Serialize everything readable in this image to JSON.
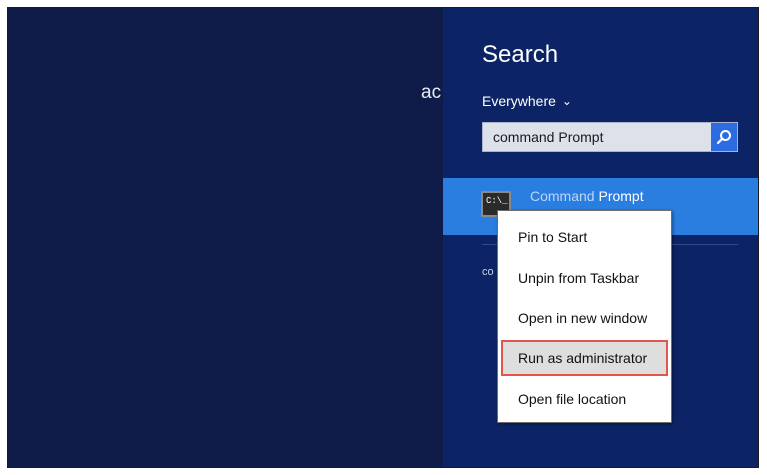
{
  "background": {
    "clipped_text": "ac"
  },
  "charm": {
    "title": "Search",
    "scope_label": "Everywhere",
    "scope_chevron": "⌄",
    "search_value": "command Prompt",
    "search_button_icon": "search-icon",
    "result": {
      "icon": "cmd-prompt-icon",
      "icon_text": "C:\\_",
      "label_light": "Command",
      "label_bold": "Prompt"
    },
    "section_label": "co"
  },
  "context_menu": {
    "items": [
      {
        "label": "Pin to Start"
      },
      {
        "label": "Unpin from Taskbar"
      },
      {
        "label": "Open in new window"
      },
      {
        "label": "Run as administrator",
        "highlighted": true
      },
      {
        "label": "Open file location"
      }
    ]
  },
  "colors": {
    "start_bg": "#0f1c4a",
    "charm_bg": "#0c2466",
    "result_bg": "#2a7ee0",
    "search_button": "#2d6ce0",
    "highlight_border": "#e2574c"
  }
}
